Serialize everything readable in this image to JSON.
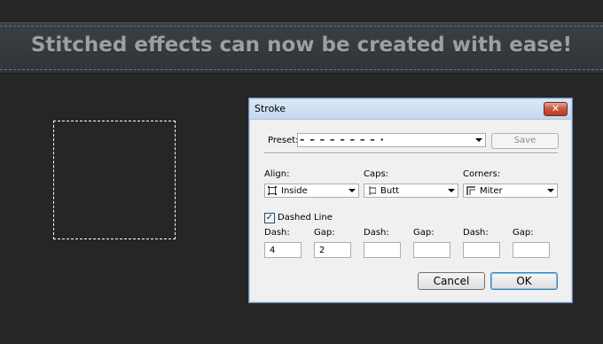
{
  "banner": {
    "text": "Stitched effects can now be created with ease!"
  },
  "dialog": {
    "title": "Stroke",
    "close_glyph": "✕",
    "preset": {
      "label": "Preset:",
      "value": "– – – – – – – – ·"
    },
    "save_label": "Save",
    "align": {
      "label": "Align:",
      "value": "Inside",
      "icon": "inside-stroke-icon"
    },
    "caps": {
      "label": "Caps:",
      "value": "Butt",
      "icon": "butt-cap-icon"
    },
    "corners": {
      "label": "Corners:",
      "value": "Miter",
      "icon": "miter-join-icon"
    },
    "dashed_line": {
      "label": "Dashed Line",
      "checked": true,
      "glyph": "✓"
    },
    "dash_gap": [
      {
        "label": "Dash:",
        "value": "4"
      },
      {
        "label": "Gap:",
        "value": "2"
      },
      {
        "label": "Dash:",
        "value": ""
      },
      {
        "label": "Gap:",
        "value": ""
      },
      {
        "label": "Dash:",
        "value": ""
      },
      {
        "label": "Gap:",
        "value": ""
      }
    ],
    "cancel_label": "Cancel",
    "ok_label": "OK"
  },
  "colors": {
    "background": "#262626",
    "banner": "#33383d",
    "dialog_border": "#6b8db4",
    "close_button": "#c8553c"
  }
}
